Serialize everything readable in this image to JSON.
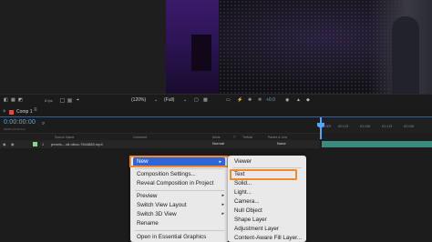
{
  "viewer_bar": {
    "zoom": "(120%)",
    "quality": "(Full)",
    "exposure": "+0.0",
    "left_text": "8 fps"
  },
  "timeline_tab": {
    "label": "Comp 1",
    "menu": "≡"
  },
  "time": {
    "timecode": "0:00:00:00",
    "sub": "00000 (24.00 fps)"
  },
  "ruler": [
    "0:00f",
    "00:12f",
    "01:00f",
    "01:12f",
    "02:00f"
  ],
  "columns": [
    "Source Name",
    "Comment",
    "Mode",
    "T",
    "TrkMat",
    "Parent & Link"
  ],
  "layer": {
    "number": "1",
    "name": "pexels-...all-nikov-7644882.mp4",
    "mode": "Normal",
    "parent": "None"
  },
  "context_menu": {
    "items": [
      {
        "label": "New",
        "submenu": true,
        "highlighted": true
      },
      {
        "label": "Composition Settings..."
      },
      {
        "label": "Reveal Composition in Project"
      },
      {
        "label": "Preview",
        "submenu": true
      },
      {
        "label": "Switch View Layout",
        "submenu": true
      },
      {
        "label": "Switch 3D View",
        "submenu": true
      },
      {
        "label": "Rename"
      },
      {
        "label": "Open in Essential Graphics"
      }
    ]
  },
  "submenu": {
    "items": [
      "Viewer",
      "Text",
      "Solid...",
      "Light...",
      "Camera...",
      "Null Object",
      "Shape Layer",
      "Adjustment Layer",
      "Content-Aware Fill Layer..."
    ]
  },
  "colors": {
    "accent": "#4fb0e8",
    "highlight": "#2f65d6",
    "callout": "#f08a2c"
  }
}
